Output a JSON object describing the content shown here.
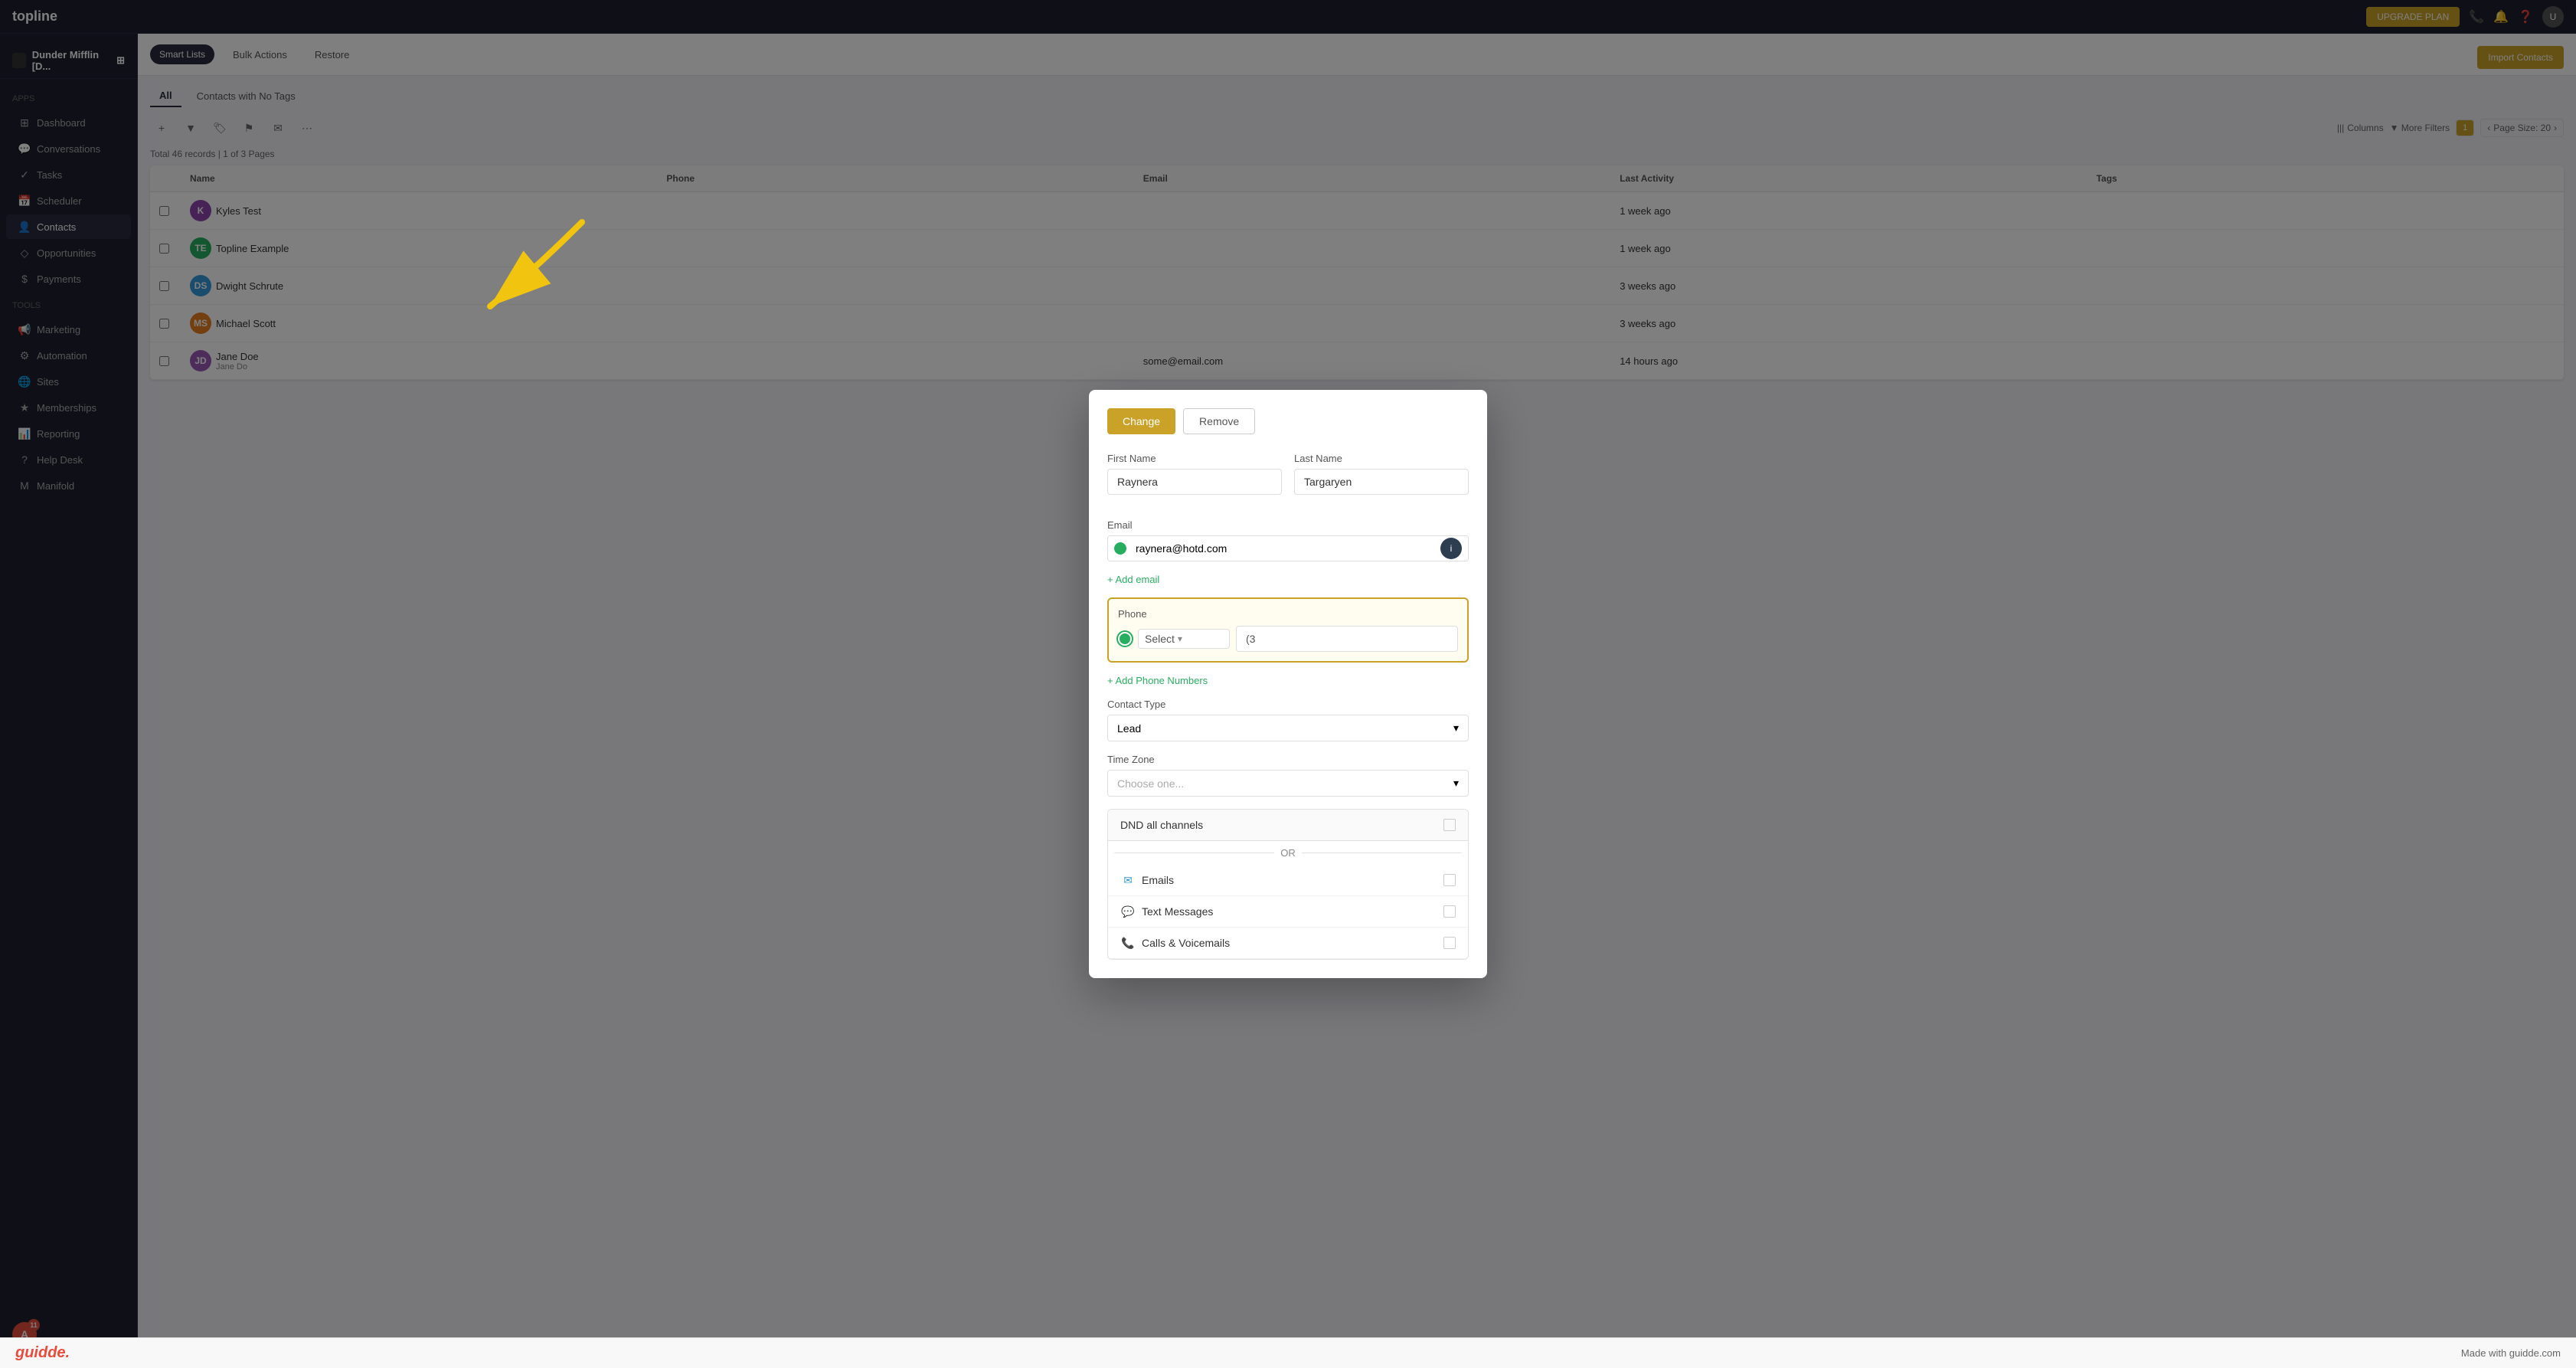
{
  "app": {
    "name": "topline",
    "company": "Dunder Mifflin [D...",
    "top_nav_btn": "UPGRADE PLAN",
    "import_contacts_btn": "Import Contacts"
  },
  "sidebar": {
    "section_apps": "Apps",
    "section_tools": "Tools",
    "items": [
      {
        "id": "dashboard",
        "label": "Dashboard",
        "icon": "⊞"
      },
      {
        "id": "conversations",
        "label": "Conversations",
        "icon": "💬"
      },
      {
        "id": "tasks",
        "label": "Tasks",
        "icon": "✓"
      },
      {
        "id": "scheduler",
        "label": "Scheduler",
        "icon": "📅"
      },
      {
        "id": "contacts",
        "label": "Contacts",
        "icon": "👤"
      },
      {
        "id": "opportunities",
        "label": "Opportunities",
        "icon": "◇"
      },
      {
        "id": "payments",
        "label": "Payments",
        "icon": "$"
      },
      {
        "id": "marketing",
        "label": "Marketing",
        "icon": "📢"
      },
      {
        "id": "automation",
        "label": "Automation",
        "icon": "⚙"
      },
      {
        "id": "sites",
        "label": "Sites",
        "icon": "🌐"
      },
      {
        "id": "memberships",
        "label": "Memberships",
        "icon": "★"
      },
      {
        "id": "reporting",
        "label": "Reporting",
        "icon": "📊"
      },
      {
        "id": "help_desk",
        "label": "Help Desk",
        "icon": "?"
      },
      {
        "id": "manifold",
        "label": "Manifold",
        "icon": "M"
      }
    ],
    "user_badge": "11"
  },
  "header": {
    "smart_lists": "Smart Lists",
    "bulk_actions": "Bulk Actions",
    "restore": "Restore"
  },
  "table": {
    "tabs": [
      {
        "label": "All",
        "active": true
      },
      {
        "label": "Contacts with No Tags",
        "active": false
      }
    ],
    "meta": "Total 46 records | 1 of 3 Pages",
    "columns": [
      "",
      "Name",
      "Phone",
      "Email",
      "Last Activity",
      "Tags"
    ],
    "page_size": "Page Size: 20",
    "rows": [
      {
        "name": "Kyles Test",
        "color": "#8e44ad"
      },
      {
        "name": "Topline Example",
        "initials": "TE",
        "color": "#27ae60"
      },
      {
        "name": "Dwight Schrute",
        "initials": "DS",
        "color": "#3498db"
      },
      {
        "name": "Michael Scott",
        "initials": "MS",
        "color": "#e67e22",
        "last_activity": "3 weeks ago"
      },
      {
        "name": "Jane Doe",
        "subtitle": "Jane Do",
        "initials": "JD",
        "color": "#9b59b6"
      }
    ]
  },
  "modal": {
    "change_btn": "Change",
    "remove_btn": "Remove",
    "first_name_label": "First Name",
    "first_name_value": "Raynera",
    "last_name_label": "Last Name",
    "last_name_value": "Targaryen",
    "email_label": "Email",
    "email_value": "raynera@hotd.com",
    "add_email_link": "+ Add email",
    "phone_label": "Phone",
    "phone_select_value": "Select",
    "phone_number_partial": "(3",
    "add_phone_link": "+ Add Phone Numbers",
    "contact_type_label": "Contact Type",
    "contact_type_value": "Lead",
    "time_zone_label": "Time Zone",
    "time_zone_placeholder": "Choose one...",
    "dnd_label": "DND all channels",
    "dnd_or": "OR",
    "dnd_items": [
      {
        "label": "Emails",
        "icon": "✉",
        "color": "#3498db"
      },
      {
        "label": "Text Messages",
        "icon": "💬",
        "color": "#27ae60"
      },
      {
        "label": "Calls & Voicemails",
        "icon": "📞",
        "color": "#3498db"
      }
    ]
  },
  "bottom_bar": {
    "logo": "guidde.",
    "credit": "Made with guidde.com"
  }
}
